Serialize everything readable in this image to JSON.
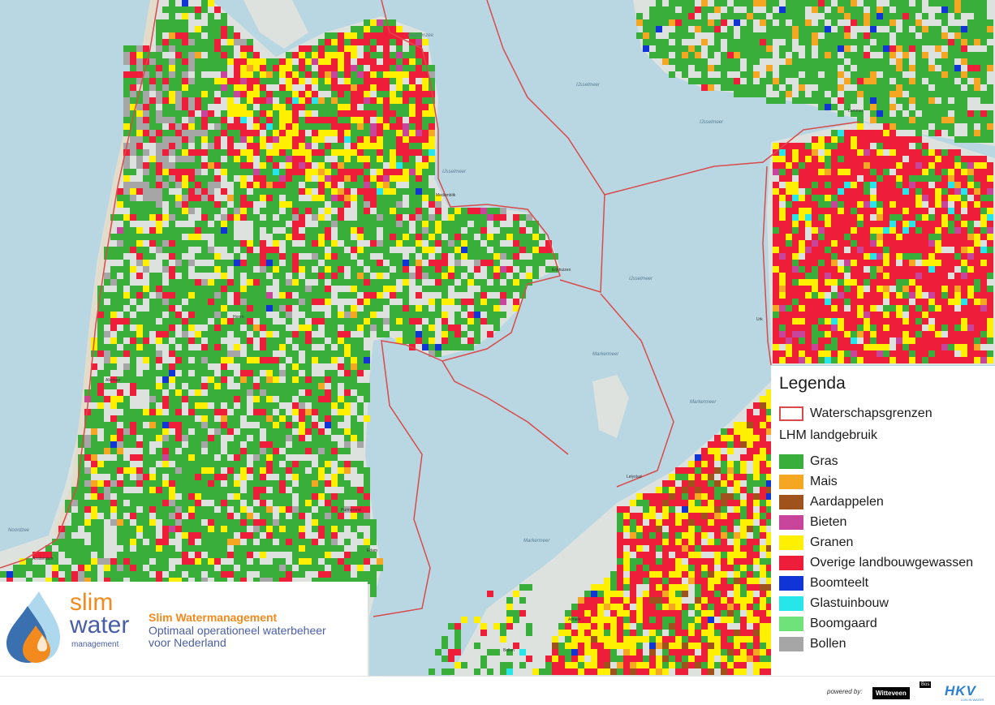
{
  "map": {
    "water_color": "#b9d7e2",
    "land_color": "#dde2de",
    "border_color": "#d94b4b",
    "region_labels": [
      "Waddenzee",
      "IJsselmeer",
      "IJsselmeer",
      "IJsselmeer",
      "IJsselmeer",
      "Markermeer",
      "Markermeer",
      "Markermeer",
      "Noordzee"
    ],
    "city_labels": [
      "Medemblik",
      "Enkhuizen",
      "Hoorn",
      "Lelystad",
      "Lemmer",
      "Urk",
      "Almere",
      "Amsterdam",
      "Purmerend",
      "Alkmaar",
      "Bollen",
      "Edam"
    ]
  },
  "legend": {
    "title": "Legenda",
    "boundary_label": "Waterschapsgrenzen",
    "subtitle": "LHM landgebruik",
    "items": [
      {
        "label": "Gras",
        "color": "#3aae3a"
      },
      {
        "label": "Mais",
        "color": "#f5a623"
      },
      {
        "label": "Aardappelen",
        "color": "#a0521c"
      },
      {
        "label": "Bieten",
        "color": "#c8459b"
      },
      {
        "label": "Granen",
        "color": "#ffef00"
      },
      {
        "label": "Overige landbouwgewassen",
        "color": "#ee1d3a"
      },
      {
        "label": "Boomteelt",
        "color": "#1034d6"
      },
      {
        "label": "Glastuinbouw",
        "color": "#27e6ea"
      },
      {
        "label": "Boomgaard",
        "color": "#6fe27a"
      },
      {
        "label": "Bollen",
        "color": "#a6a6a6"
      }
    ]
  },
  "logo": {
    "word1": "slim",
    "word2": "water",
    "word3": "management",
    "project_title": "Slim Watermanagement",
    "project_line1": "Optimaal operationeel waterbeheer",
    "project_line2": "voor Nederland"
  },
  "footer": {
    "powered_by": "powered by:",
    "partner1": "Witteveen",
    "partner1_tag": "Bos",
    "partner2": "HKV",
    "partner2_sub": "LIJN IN WATER"
  }
}
